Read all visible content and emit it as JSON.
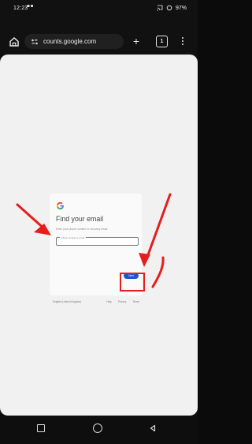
{
  "status_bar": {
    "time": "12:23",
    "battery": "97%"
  },
  "browser": {
    "url": "counts.google.com",
    "tab_count": "1"
  },
  "page": {
    "title": "Find your email",
    "subtitle": "Enter your phone number or recovery email",
    "email_label": "Phone number or email",
    "next_label": "Next",
    "footer_language": "English (United Kingdom)",
    "footer_links": [
      "Help",
      "Privacy",
      "Terms"
    ]
  },
  "colors": {
    "accent": "#1e56c8",
    "annotation_red": "#e61d1d"
  },
  "icons": {
    "home": "home-icon",
    "site_info": "site-info-icon",
    "add_tab": "plus-icon",
    "menu": "more-vert-icon",
    "google": "google-logo",
    "recents": "square-icon",
    "home_nav": "circle-icon",
    "back": "triangle-back-icon"
  }
}
